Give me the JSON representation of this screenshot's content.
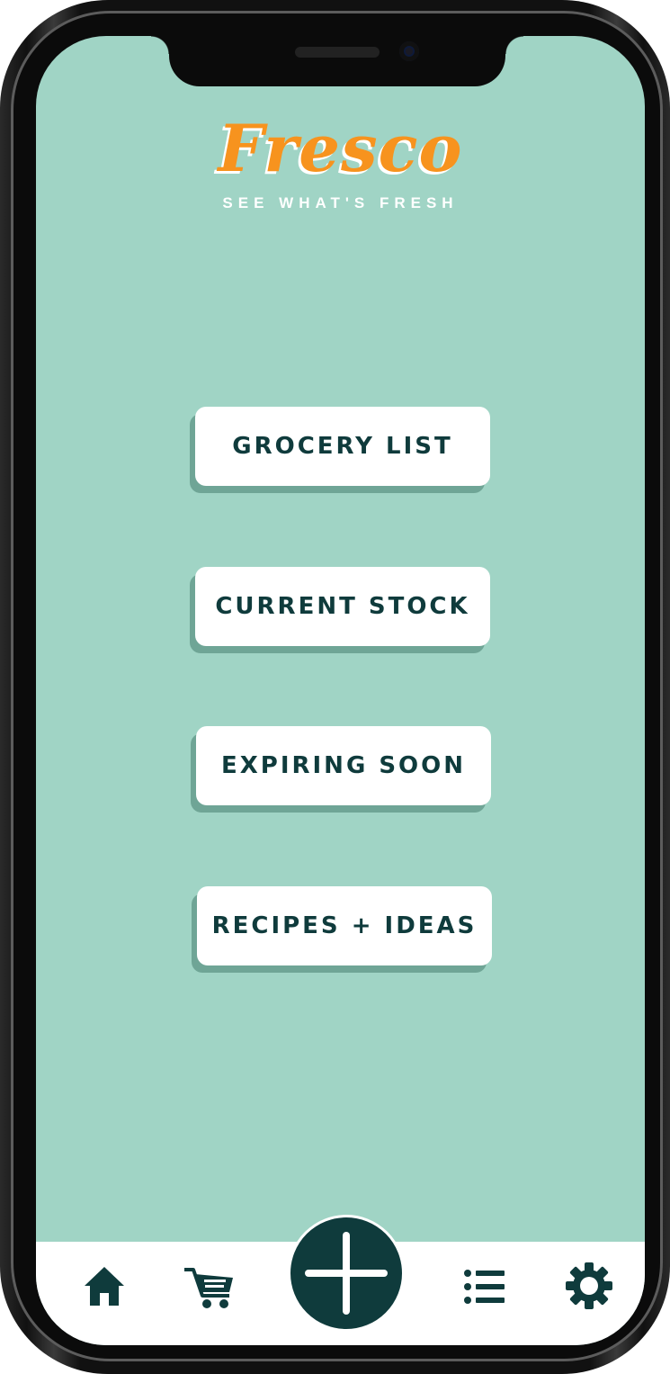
{
  "app": {
    "logo_text": "Fresco",
    "tagline": "SEE WHAT'S FRESH"
  },
  "menu": {
    "buttons": [
      {
        "label": "GROCERY LIST"
      },
      {
        "label": "CURRENT STOCK"
      },
      {
        "label": "EXPIRING SOON"
      },
      {
        "label": "RECIPES + IDEAS"
      }
    ]
  },
  "tabbar": {
    "items": [
      {
        "icon": "home-icon"
      },
      {
        "icon": "cart-icon"
      },
      {
        "icon": "plus-icon"
      },
      {
        "icon": "list-icon"
      },
      {
        "icon": "gear-icon"
      }
    ]
  },
  "colors": {
    "background": "#a0d4c5",
    "accent": "#f7931e",
    "dark": "#0f3b3c",
    "button_shadow": "#6fa596"
  }
}
